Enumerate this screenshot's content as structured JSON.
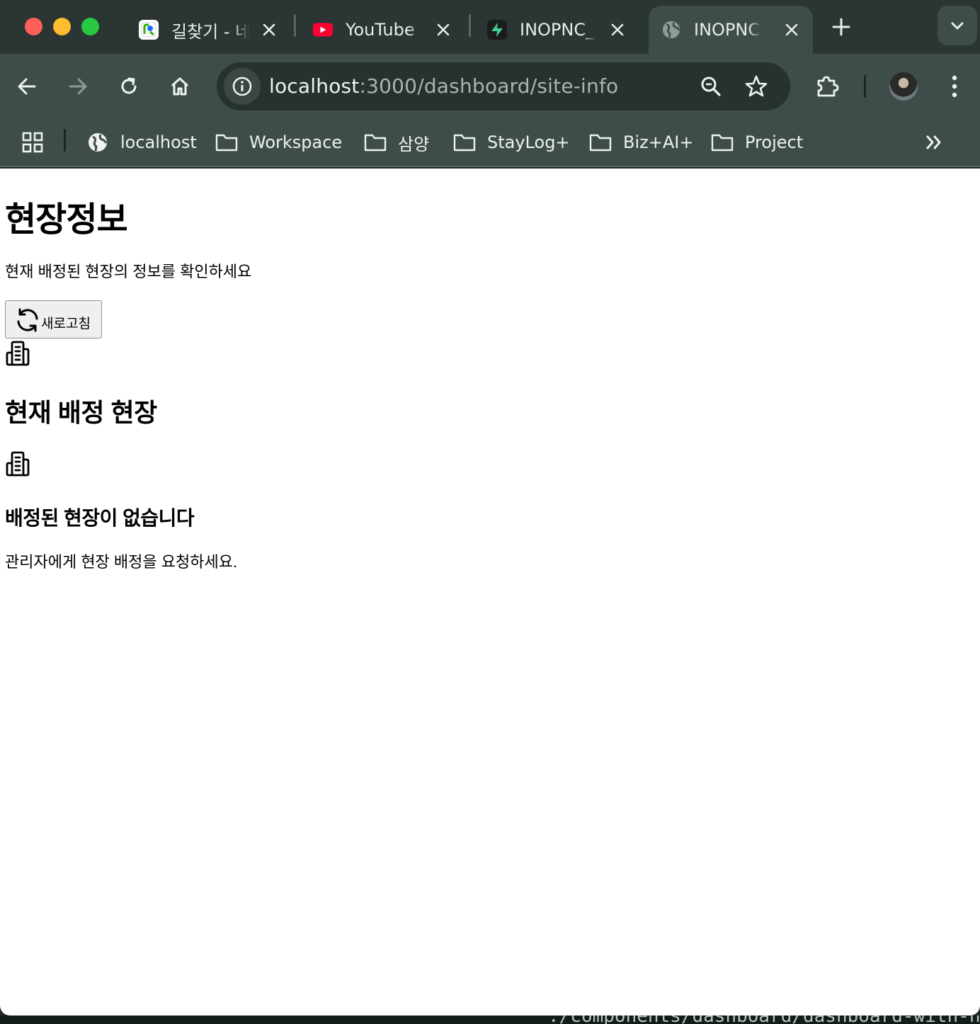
{
  "browser": {
    "tabs": [
      {
        "title": "길찾기 - 네",
        "icon": "naver-map-icon",
        "active": false
      },
      {
        "title": "YouTube",
        "icon": "youtube-icon",
        "active": false
      },
      {
        "title": "INOPNC_",
        "icon": "supabase-icon",
        "active": false
      },
      {
        "title": "INOPNC ",
        "icon": "globe-icon",
        "active": true
      }
    ],
    "url": {
      "host": "localhost",
      "rest": ":3000/dashboard/site-info"
    },
    "bookmarks": [
      {
        "label": "localhost",
        "icon": "globe-icon"
      },
      {
        "label": "Workspace",
        "icon": "folder-icon"
      },
      {
        "label": "삼양",
        "icon": "folder-icon"
      },
      {
        "label": "StayLog+",
        "icon": "folder-icon"
      },
      {
        "label": "Biz+AI+",
        "icon": "folder-icon"
      },
      {
        "label": "Project",
        "icon": "folder-icon"
      }
    ],
    "colors": {
      "frame": "#2b3533",
      "toolbar": "#3e4d49",
      "omnibox": "#27322f"
    }
  },
  "page": {
    "title": "현장정보",
    "subtitle": "현재 배정된 현장의 정보를 확인하세요",
    "refresh_label": "새로고침",
    "section_title": "현재 배정 현장",
    "empty_title": "배정된 현장이 없습니다",
    "empty_message": "관리자에게 현장 배정을 요청하세요."
  },
  "terminal": {
    "text": "./components/dashboard/dashboard-with-notif"
  }
}
